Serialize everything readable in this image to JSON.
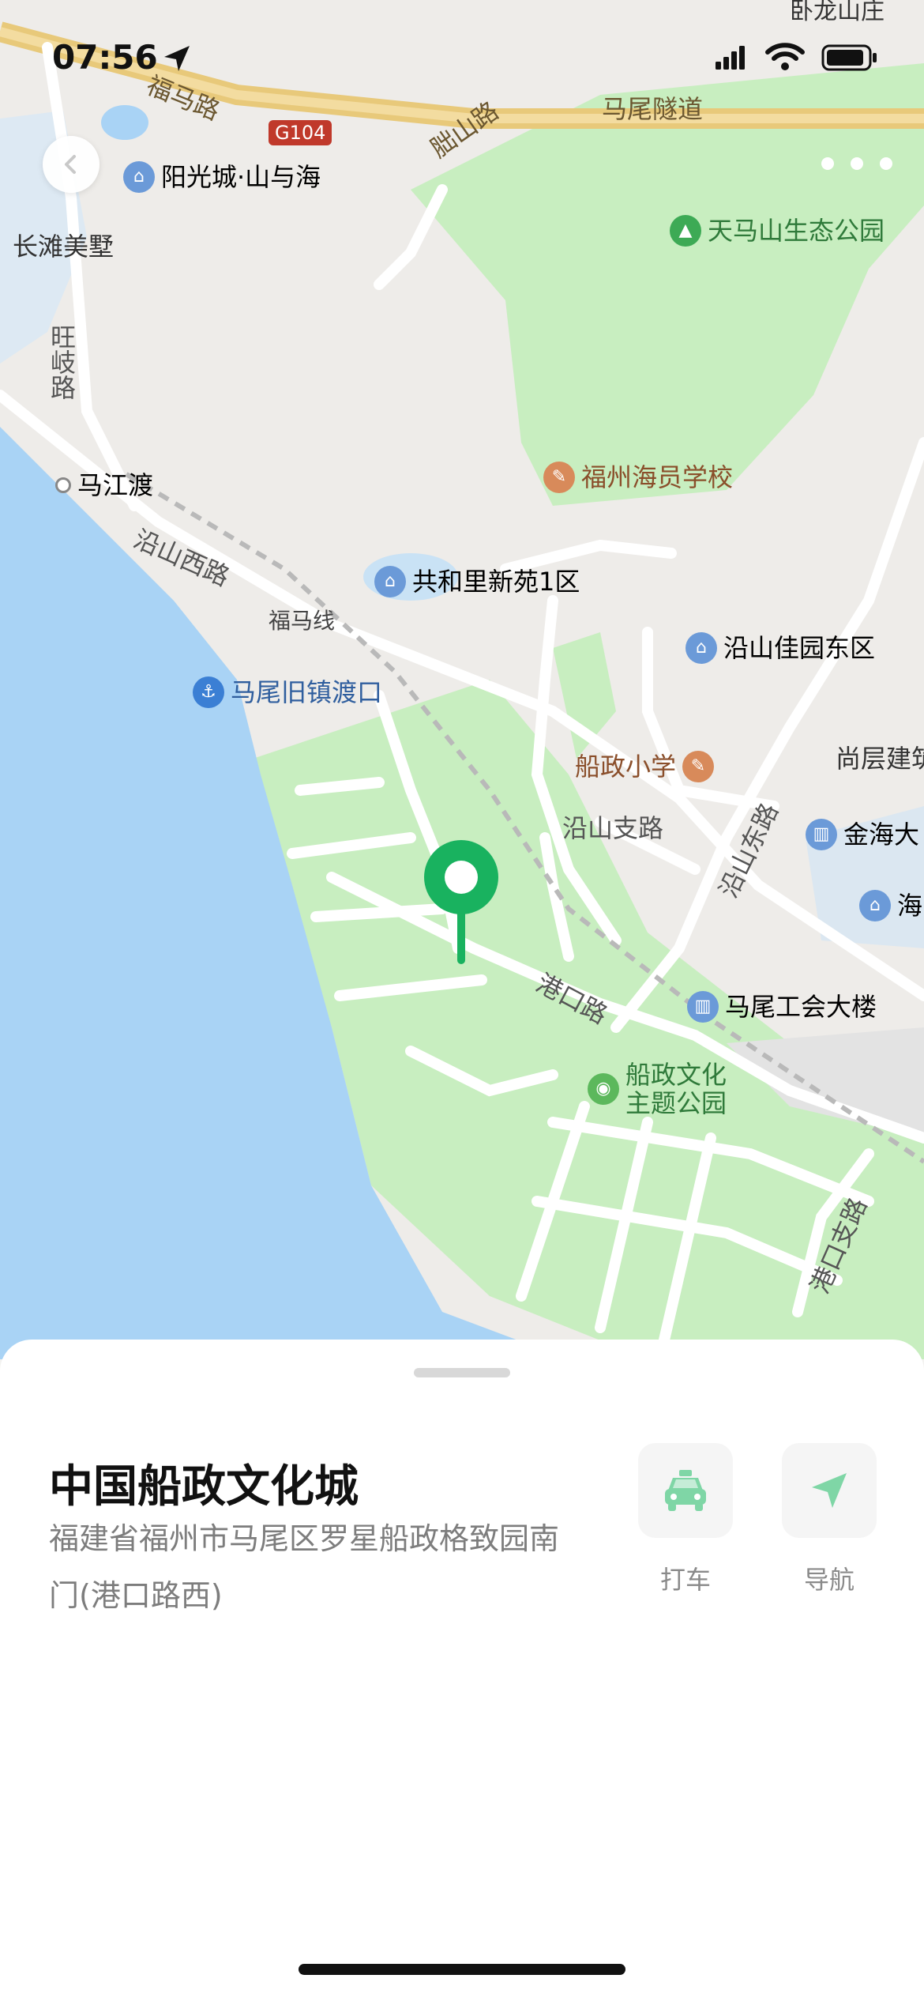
{
  "status_bar": {
    "time": "07:56"
  },
  "map": {
    "place_labels": {
      "wolongshan": "卧龙山庄",
      "changtan": "长滩美墅",
      "majiangdu": "马江渡",
      "fumaxian": "福马线"
    },
    "road_labels": {
      "fuma_road": "福马路",
      "g104": "G104",
      "dansha_road": "胐山路",
      "mawei_tunnel": "马尾隧道",
      "wangqi_road": "旺岐路",
      "yanshan_west": "沿山西路",
      "yanshan_branch": "沿山支路",
      "yanshan_east": "沿山东路",
      "gangkou_road": "港口路",
      "gangkou_branch": "港口支路"
    },
    "pois": {
      "yangguangcheng": "阳光城·山与海",
      "tianmashan": "天马山生态公园",
      "seafarer_school": "福州海员学校",
      "gonghe": "共和里新苑1区",
      "yanshan_jiayuan": "沿山佳园东区",
      "ferry": "马尾旧镇渡口",
      "chuanzheng_school": "船政小学",
      "shangceng": "尚层建筑",
      "jinhai": "金海大",
      "hai": "海",
      "union_building": "马尾工会大楼",
      "park_line1": "船政文化",
      "park_line2": "主题公园"
    }
  },
  "place": {
    "name": "中国船政文化城",
    "address": "福建省福州市马尾区罗星船政格致园南门(港口路西)"
  },
  "actions": {
    "taxi_label": "打车",
    "navigate_label": "导航"
  },
  "colors": {
    "water": "#a9d3f5",
    "green": "#c8eec0",
    "pin": "#19b25f",
    "expressway": "#e8c97a"
  }
}
